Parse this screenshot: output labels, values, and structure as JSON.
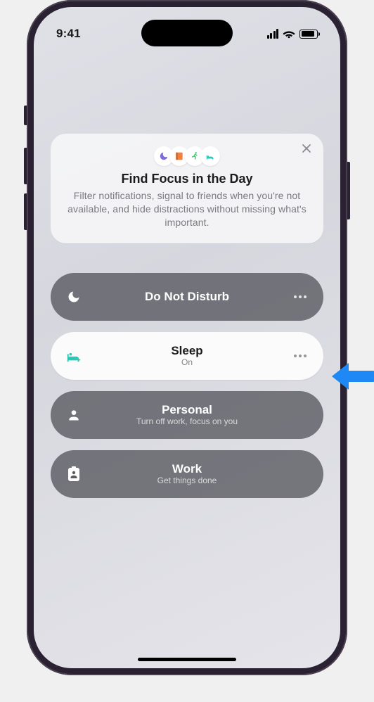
{
  "status": {
    "time": "9:41"
  },
  "hero": {
    "title": "Find Focus in the Day",
    "description": "Filter notifications, signal to friends when you're not available, and hide distractions without missing what's important.",
    "icons": [
      "moon",
      "book",
      "runner",
      "bed"
    ],
    "iconColors": {
      "moon": "#7b6bdb",
      "book": "#f0813f",
      "runner": "#42c772",
      "bed": "#2dc7b8"
    }
  },
  "focusModes": [
    {
      "id": "dnd",
      "icon": "moon",
      "label": "Do Not Disturb",
      "subtitle": "",
      "active": false
    },
    {
      "id": "sleep",
      "icon": "bed",
      "label": "Sleep",
      "subtitle": "On",
      "active": true
    },
    {
      "id": "personal",
      "icon": "person",
      "label": "Personal",
      "subtitle": "Turn off work, focus on you",
      "active": false
    },
    {
      "id": "work",
      "icon": "badge",
      "label": "Work",
      "subtitle": "Get things done",
      "active": false
    }
  ]
}
